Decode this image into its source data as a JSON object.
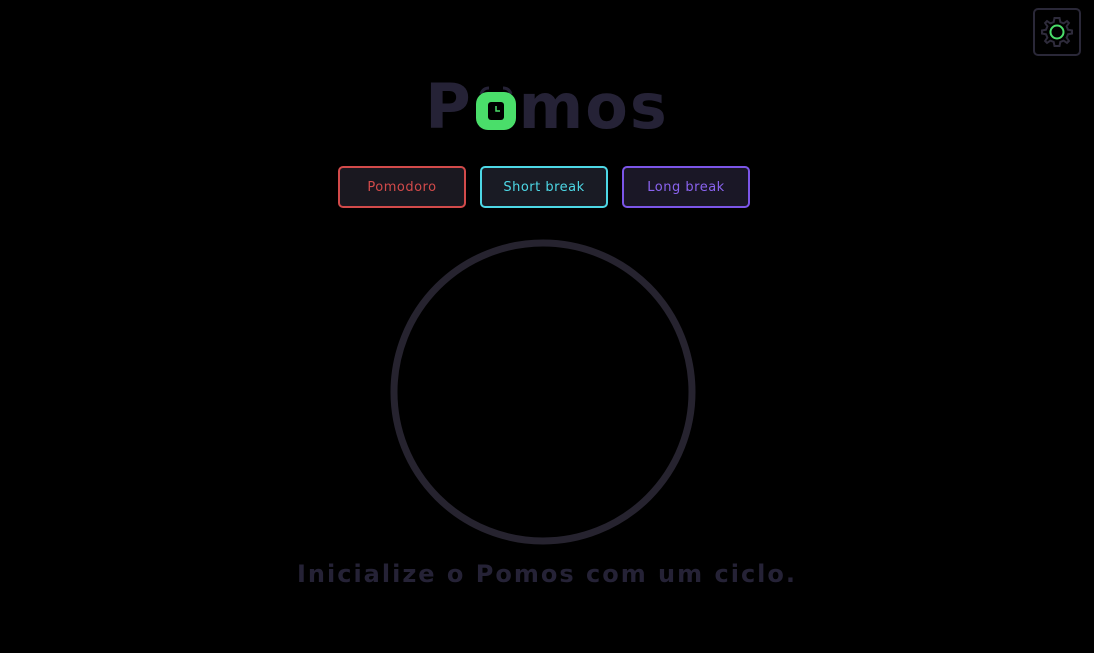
{
  "app": {
    "logo_prefix": "P",
    "logo_suffix": "mos"
  },
  "settings": {
    "icon": "gear-icon",
    "accent": "#4ade6a"
  },
  "modes": [
    {
      "label": "Pomodoro",
      "color": "#d24a4a"
    },
    {
      "label": "Short break",
      "color": "#4dd8e6"
    },
    {
      "label": "Long break",
      "color": "#7b55e8"
    }
  ],
  "timer": {
    "ring_color": "#26232f"
  },
  "status": {
    "message": "Inicialize o Pomos com um ciclo."
  },
  "colors": {
    "background": "#000000",
    "logo_muted": "#252236",
    "logo_accent": "#4ade6a"
  }
}
